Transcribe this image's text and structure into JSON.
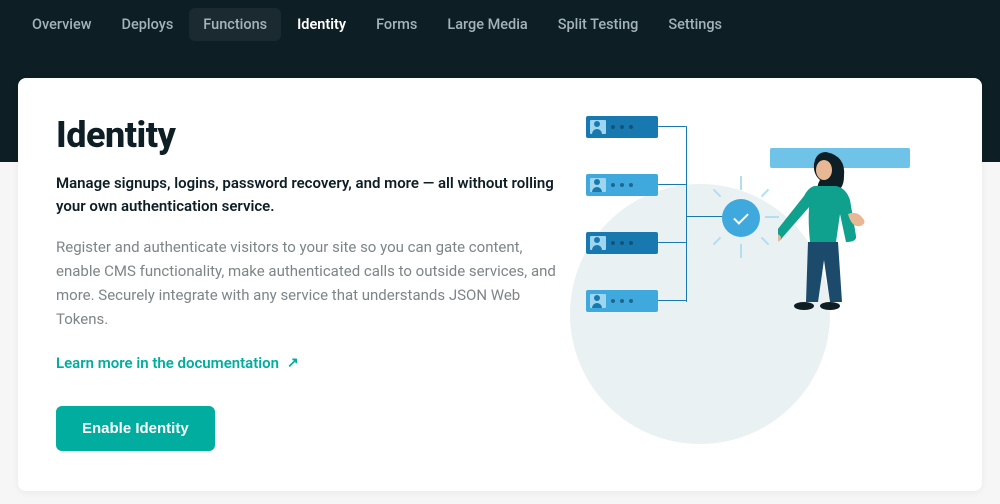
{
  "nav": {
    "items": [
      {
        "label": "Overview",
        "state": "normal"
      },
      {
        "label": "Deploys",
        "state": "normal"
      },
      {
        "label": "Functions",
        "state": "hover"
      },
      {
        "label": "Identity",
        "state": "active"
      },
      {
        "label": "Forms",
        "state": "normal"
      },
      {
        "label": "Large Media",
        "state": "normal"
      },
      {
        "label": "Split Testing",
        "state": "normal"
      },
      {
        "label": "Settings",
        "state": "normal"
      }
    ]
  },
  "page": {
    "title": "Identity",
    "subtitle": "Manage signups, logins, password recovery, and more — all without rolling your own authentication service.",
    "body": "Register and authenticate visitors to your site so you can gate content, enable CMS functionality, make authenticated calls to outside services, and more. Securely integrate with any service that understands JSON Web Tokens.",
    "doc_link_label": "Learn more in the documentation",
    "doc_link_arrow": "↗",
    "enable_button_label": "Enable Identity"
  },
  "colors": {
    "accent": "#00ad9f",
    "topbar": "#0e1e25",
    "illustration_primary": "#3fa9de",
    "illustration_dark": "#1879b0"
  }
}
